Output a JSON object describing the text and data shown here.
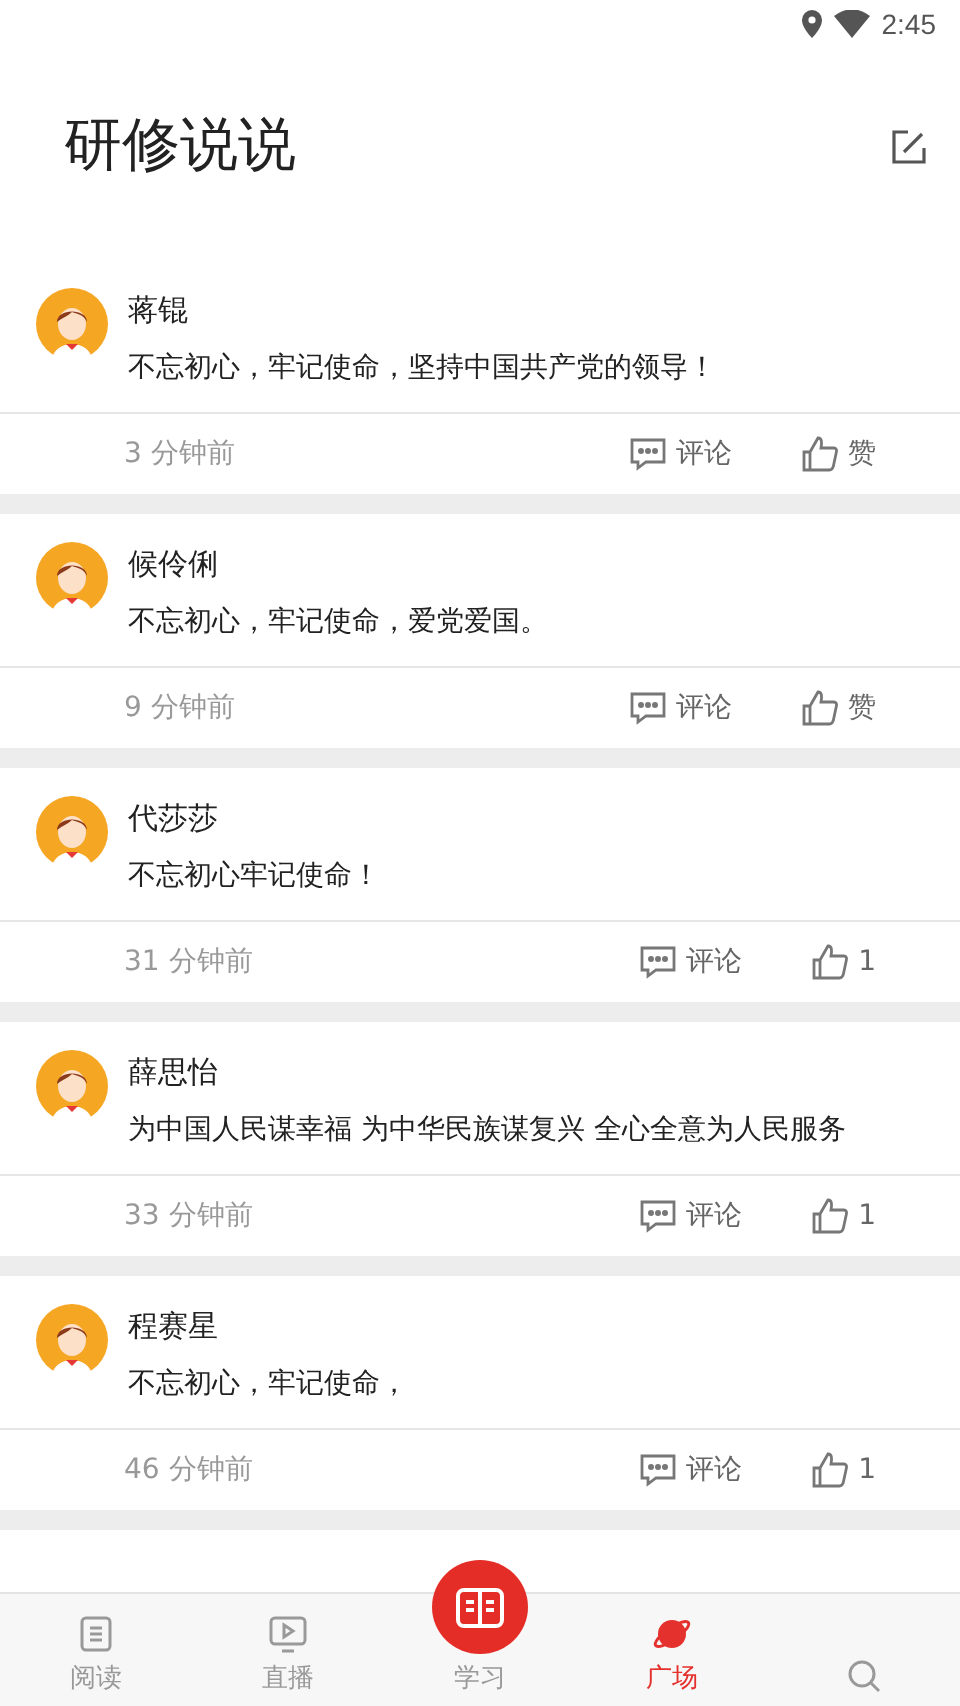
{
  "status_bar": {
    "time": "2:45"
  },
  "header": {
    "title": "研修说说"
  },
  "posts": [
    {
      "author": "蒋锟",
      "text": "不忘初心，牢记使命，坚持中国共产党的领导！",
      "time": "3 分钟前",
      "comment_label": "评论",
      "like_label": "赞"
    },
    {
      "author": "候伶俐",
      "text": "不忘初心，牢记使命，爱党爱国。",
      "time": "9 分钟前",
      "comment_label": "评论",
      "like_label": "赞"
    },
    {
      "author": "代莎莎",
      "text": "不忘初心牢记使命！",
      "time": "31 分钟前",
      "comment_label": "评论",
      "like_label": "1"
    },
    {
      "author": "薛思怡",
      "text": "为中国人民谋幸福 为中华民族谋复兴 全心全意为人民服务",
      "time": "33 分钟前",
      "comment_label": "评论",
      "like_label": "1"
    },
    {
      "author": "程赛星",
      "text": "不忘初心，牢记使命，",
      "time": "46 分钟前",
      "comment_label": "评论",
      "like_label": "1"
    }
  ],
  "bottom_nav": [
    {
      "kind": "doc",
      "label": "阅读",
      "selected": false
    },
    {
      "kind": "video",
      "label": "直播",
      "selected": false
    },
    {
      "kind": "center",
      "label": "学习",
      "selected": false
    },
    {
      "kind": "planet",
      "label": "广场",
      "selected": true
    },
    {
      "kind": "search",
      "selected": false
    }
  ]
}
